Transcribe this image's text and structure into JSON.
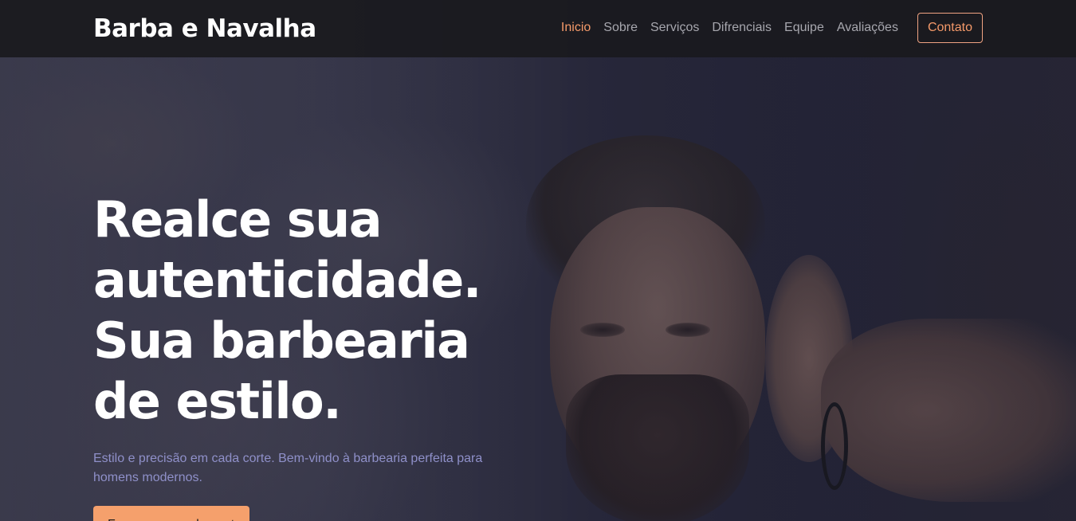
{
  "header": {
    "brand": "Barba e Navalha",
    "nav": [
      {
        "label": "Inicio",
        "active": true
      },
      {
        "label": "Sobre",
        "active": false
      },
      {
        "label": "Serviços",
        "active": false
      },
      {
        "label": "Difrenciais",
        "active": false
      },
      {
        "label": "Equipe",
        "active": false
      },
      {
        "label": "Avaliações",
        "active": false
      }
    ],
    "contact_label": "Contato"
  },
  "hero": {
    "title_lines": [
      "Realce sua",
      "autenticidade.",
      "Sua barbearia",
      "de estilo."
    ],
    "subtitle": "Estilo e precisão em cada corte. Bem-vindo à barbearia perfeita para homens modernos.",
    "cta_label": "Faça seu agendamento"
  },
  "colors": {
    "accent": "#f59a6a",
    "header_bg": "#1a1a1e",
    "subtitle": "#8f90c9"
  }
}
